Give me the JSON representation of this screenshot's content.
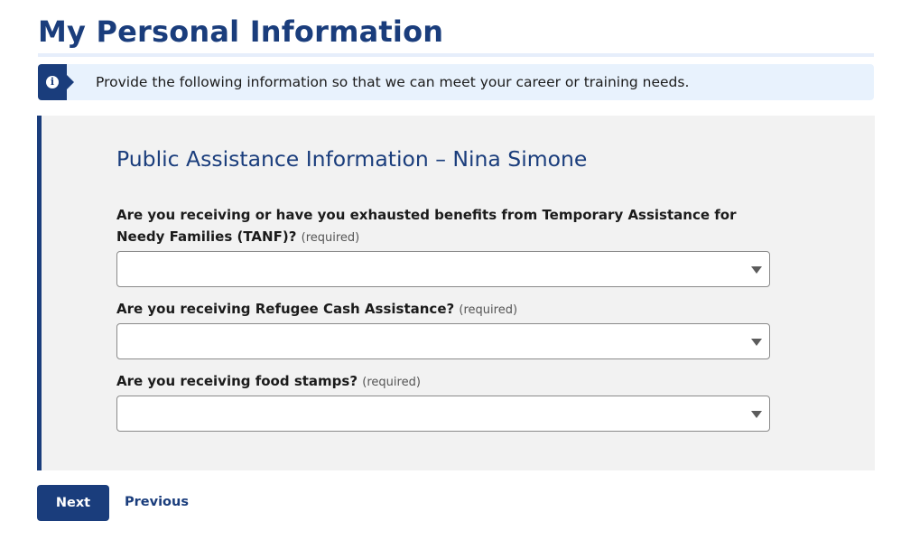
{
  "page": {
    "title": "My Personal Information"
  },
  "info_banner": {
    "icon": "info-icon",
    "icon_glyph": "i",
    "text": "Provide the following information so that we can meet your career or training needs."
  },
  "form": {
    "heading": "Public Assistance Information – Nina Simone",
    "fields": [
      {
        "label": "Are you receiving or have you exhausted benefits from Temporary Assistance for Needy Families (TANF)?",
        "required_text": "(required)",
        "value": ""
      },
      {
        "label": "Are you receiving Refugee Cash Assistance?",
        "required_text": "(required)",
        "value": ""
      },
      {
        "label": "Are you receiving food stamps?",
        "required_text": "(required)",
        "value": ""
      }
    ]
  },
  "actions": {
    "next_label": "Next",
    "previous_label": "Previous"
  },
  "colors": {
    "primary": "#1a3d7c",
    "banner_bg": "#e8f2fd",
    "panel_bg": "#f2f2f2"
  }
}
